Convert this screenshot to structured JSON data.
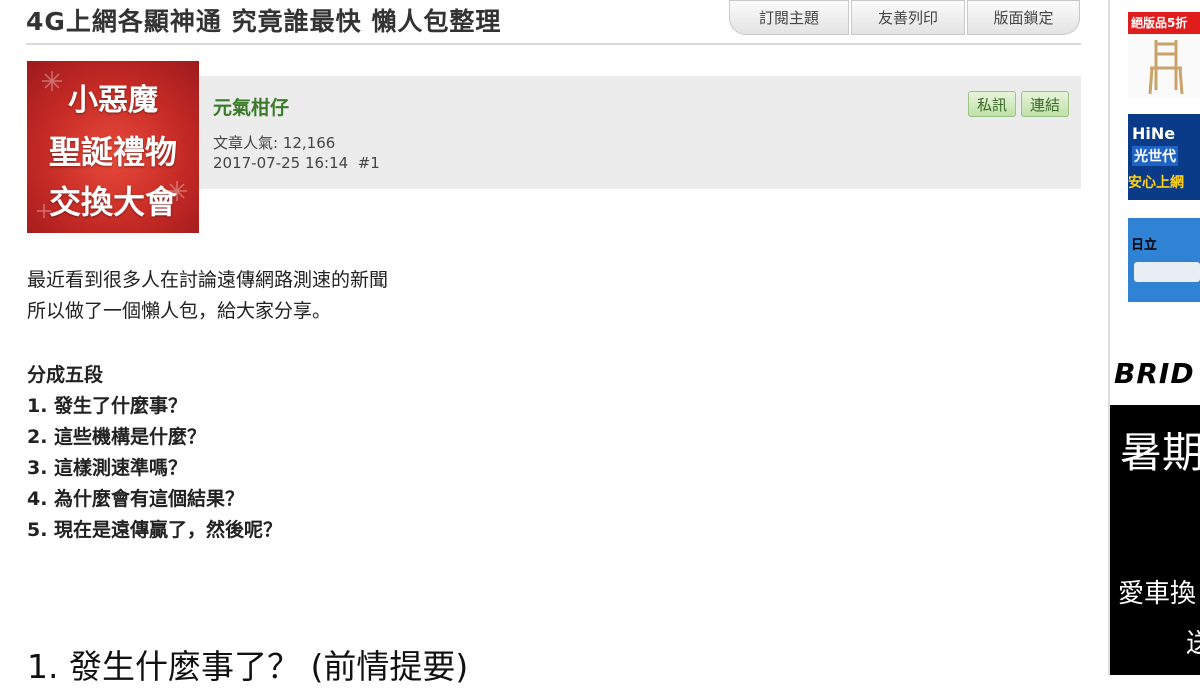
{
  "thread": {
    "title": "4G上網各顯神通 究竟誰最快 懶人包整理",
    "toolbar": [
      "訂閱主題",
      "友善列印",
      "版面鎖定"
    ]
  },
  "post": {
    "avatar_text": [
      "小惡魔",
      "聖誕禮物",
      "交換大會"
    ],
    "username": "元氣柑仔",
    "popularity": "文章人氣: 12,166",
    "datetime": "2017-07-25 16:14",
    "post_no": "#1",
    "actions": [
      "私訊",
      "連結"
    ],
    "intro": [
      "最近看到很多人在討論遠傳網路測速的新聞",
      "所以做了一個懶人包，給大家分享。"
    ],
    "sections_heading": "分成五段",
    "sections": [
      "1. 發生了什麼事？",
      "2. 這些機構是什麼？",
      "3. 這樣測速準嗎？",
      "4. 為什麼會有這個結果？",
      "5. 現在是遠傳贏了，然後呢？"
    ],
    "section1_title": "1. 發生什麼事了？ (前情提要)"
  },
  "sidebar": {
    "ad1_label": "絕版品5折",
    "ad2_text": [
      "HiNe",
      "光世代",
      "安心上網"
    ],
    "ad3_text": "日立",
    "ad_big_brand": "BRID",
    "ad_big_text": [
      "暑期",
      "愛車換",
      "送"
    ]
  }
}
